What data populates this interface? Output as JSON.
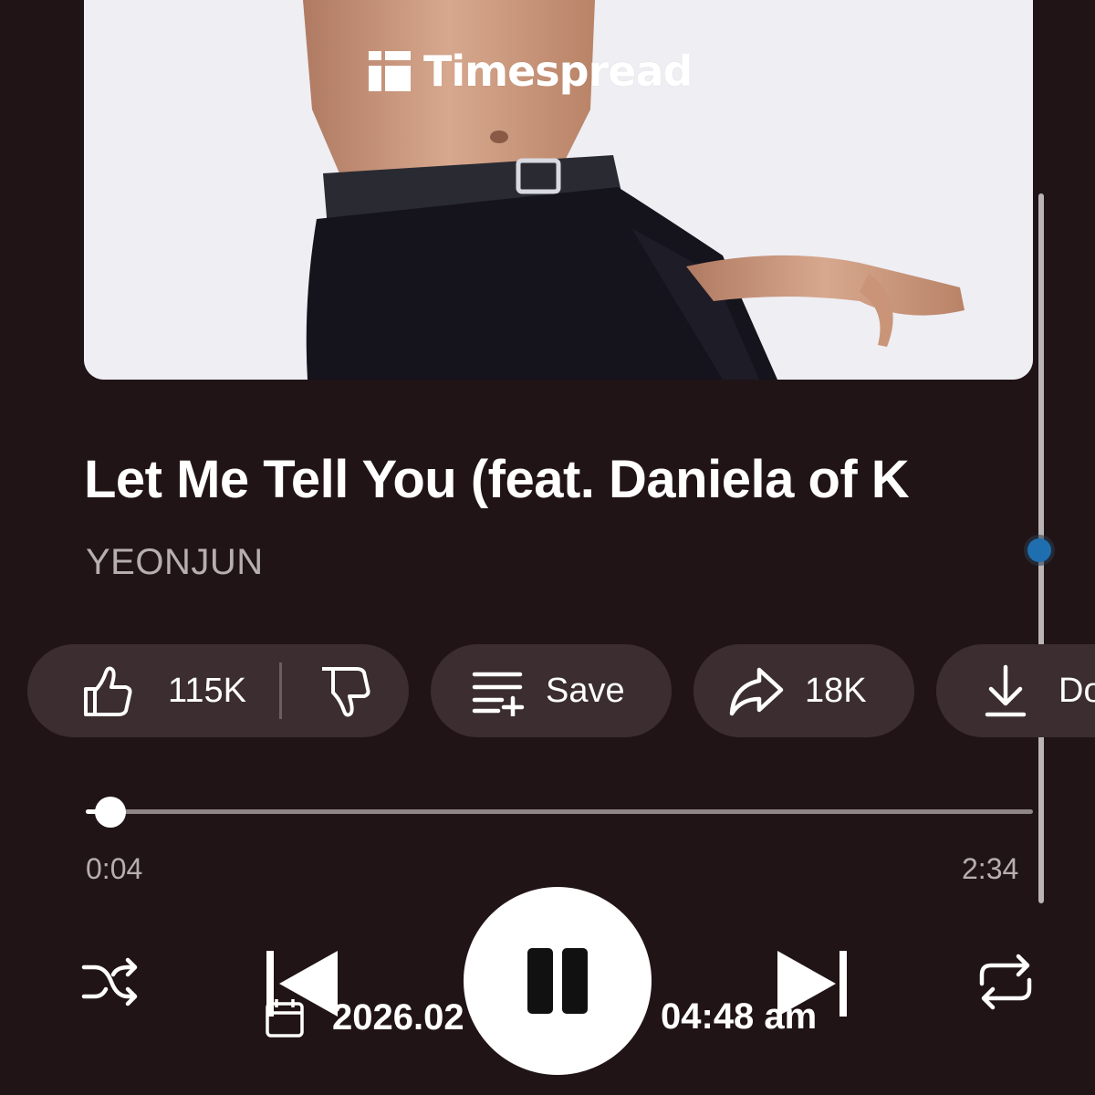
{
  "watermark": {
    "text": "Timespread"
  },
  "track": {
    "title": "Let Me Tell You (feat. Daniela of K",
    "artist": "YEONJUN"
  },
  "actions": {
    "like_count": "115K",
    "save_label": "Save",
    "share_count": "18K",
    "download_label": "Do"
  },
  "playback": {
    "current_time": "0:04",
    "total_time": "2:34",
    "progress_fraction": 0.026,
    "state": "playing"
  },
  "stamp": {
    "date": "2026.02",
    "time": "04:48 am"
  },
  "colors": {
    "background": "#211416",
    "chip": "#3b2d30",
    "accent_scroll": "#1f6fb0",
    "secondary_text": "#b6aeb0"
  }
}
